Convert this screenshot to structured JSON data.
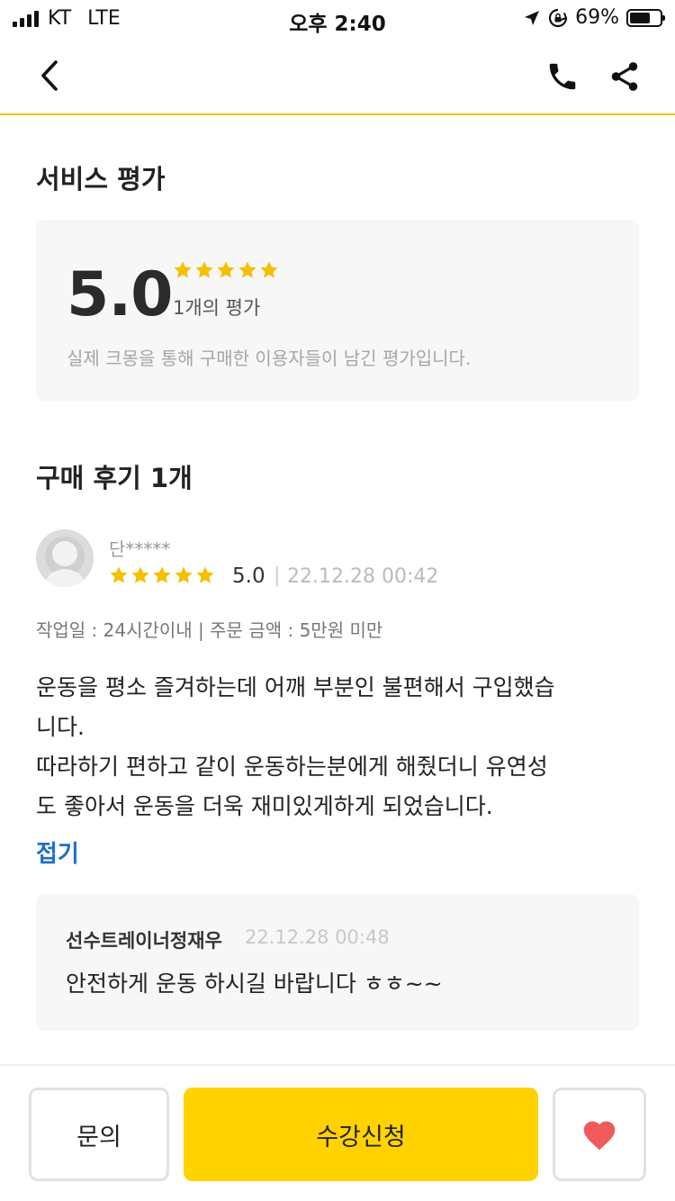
{
  "status_bar": {
    "carrier": "KT",
    "network": "LTE",
    "time": "오후 2:40",
    "battery_percent": "69%",
    "battery_level": 0.69
  },
  "nav": {
    "icons": [
      "back-chevron-icon",
      "phone-icon",
      "share-icon"
    ]
  },
  "service_rating": {
    "title": "서비스 평가",
    "score": "5.0",
    "stars": 5,
    "count": "1개의 평가",
    "note": "실제 크몽을 통해 구매한 이용자들이 남긴 평가입니다."
  },
  "reviews": {
    "title": "구매 후기 1개",
    "items": [
      {
        "reviewer": "단*****",
        "stars": 5,
        "score": "5.0",
        "separator": "|",
        "date": "22.12.28 00:42",
        "work_info": "작업일 : 24시간이내 | 주문 금액 : 5만원 미만",
        "body_lines": [
          "운동을 평소 즐겨하는데 어깨 부분인 불편해서 구입했습",
          "니다.",
          "따라하기 편하고 같이 운동하는분에게 해줬더니 유연성",
          "도 좋아서 운동을 더욱 재미있게하게 되었습니다."
        ],
        "collapse_label": "접기",
        "reply": {
          "author": "선수트레이너정재우",
          "date": "22.12.28 00:48",
          "text": "안전하게 운동 하시길 바랍니다 ㅎㅎ~~"
        }
      }
    ]
  },
  "bottom_bar": {
    "inquiry_label": "문의",
    "apply_label": "수강신청",
    "like_icon": "heart-icon"
  },
  "colors": {
    "accent": "#ffd200",
    "star": "#f5c000",
    "link": "#1f6fc6",
    "heart": "#f05a5a"
  }
}
